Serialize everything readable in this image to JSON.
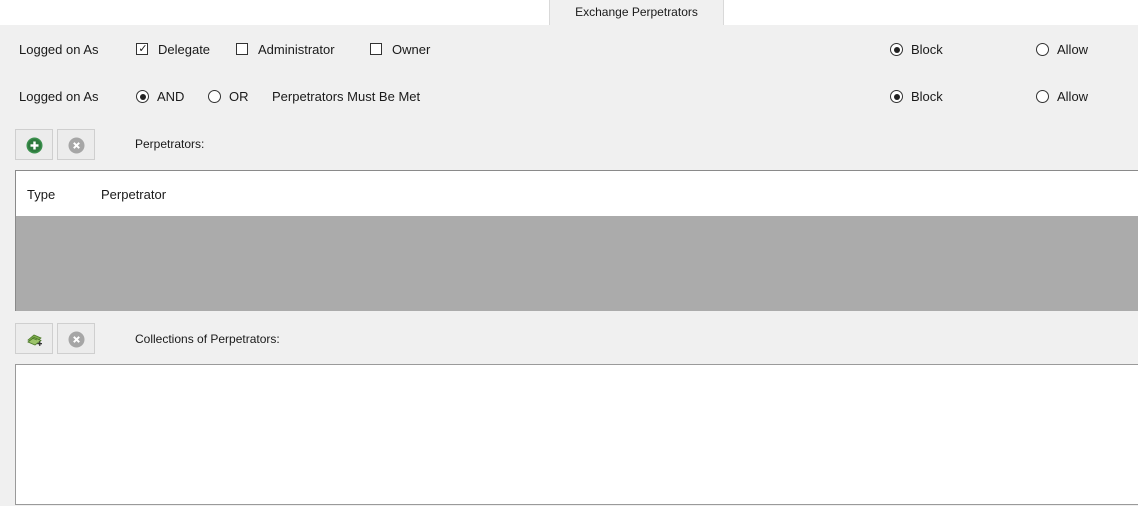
{
  "tab": {
    "label": "Exchange Perpetrators"
  },
  "row1": {
    "label": "Logged on As",
    "options": [
      {
        "label": "Delegate",
        "checked": true
      },
      {
        "label": "Administrator",
        "checked": false
      },
      {
        "label": "Owner",
        "checked": false
      }
    ],
    "block_label": "Block",
    "allow_label": "Allow",
    "selected": "Block"
  },
  "row2": {
    "label": "Logged on As",
    "and_label": "AND",
    "or_label": "OR",
    "selected_logic": "AND",
    "suffix": "Perpetrators Must Be Met",
    "block_label": "Block",
    "allow_label": "Allow",
    "selected": "Block"
  },
  "perpetrators": {
    "label": "Perpetrators:",
    "add_icon": "add-circle-icon",
    "remove_icon": "remove-circle-icon",
    "columns": [
      "Type",
      "Perpetrator"
    ],
    "rows": []
  },
  "collections": {
    "label": "Collections of Perpetrators:",
    "add_icon": "add-collection-icon",
    "remove_icon": "remove-circle-icon",
    "items": []
  },
  "colors": {
    "accent_green": "#3a8f4c",
    "disabled_icon": "#a6a6a6",
    "empty_grid": "#ababab"
  }
}
